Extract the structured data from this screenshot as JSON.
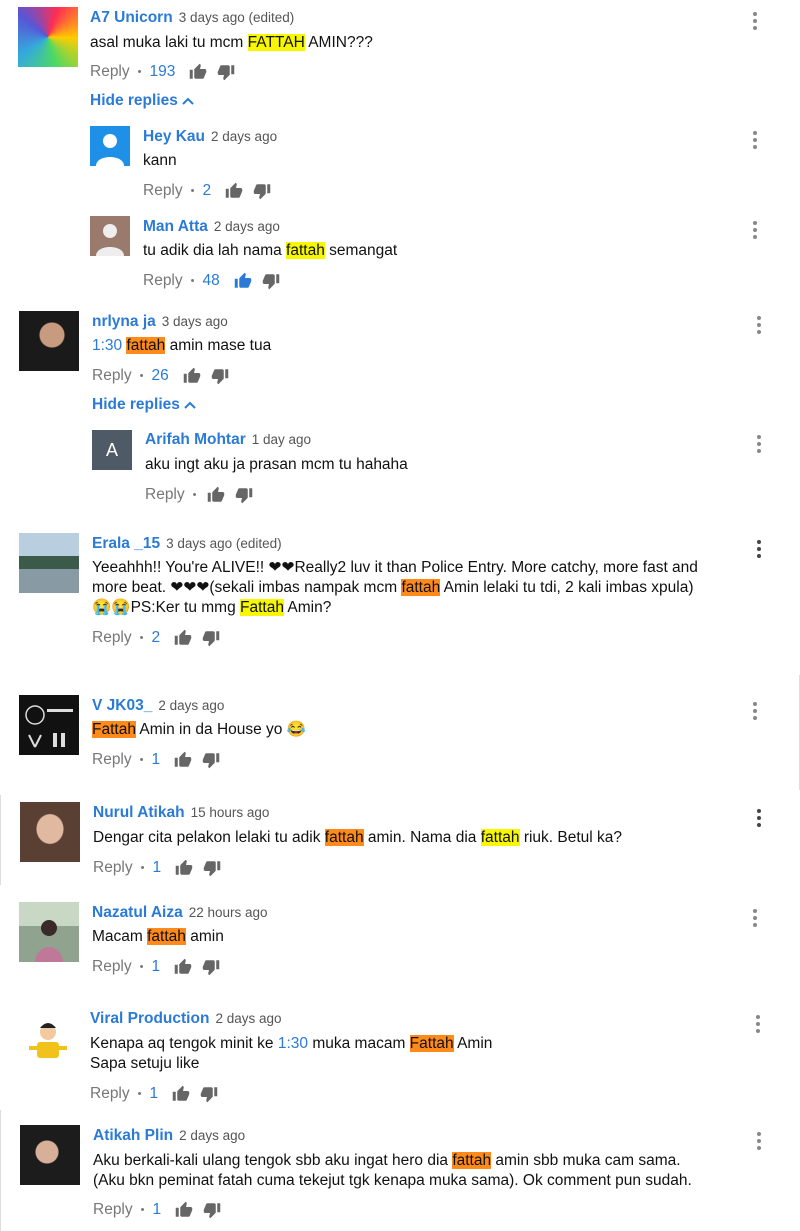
{
  "comments": [
    {
      "author": "A7 Unicorn",
      "time": "3 days ago (edited)",
      "reply": "Reply",
      "count": "193",
      "text_parts": [
        {
          "t": "asal muka laki tu mcm "
        },
        {
          "t": "FATTAH",
          "h": "y"
        },
        {
          "t": " AMIN???"
        }
      ],
      "hide": "Hide replies"
    },
    {
      "author": "Hey Kau",
      "time": "2 days ago",
      "reply": "Reply",
      "count": "2",
      "text_parts": [
        {
          "t": "kann"
        }
      ]
    },
    {
      "author": "Man Atta",
      "time": "2 days ago",
      "reply": "Reply",
      "count": "48",
      "text_parts": [
        {
          "t": "tu adik dia lah nama "
        },
        {
          "t": "fattah",
          "h": "y"
        },
        {
          "t": " semangat"
        }
      ]
    },
    {
      "author": "nrlyna ja",
      "time": "3 days ago",
      "reply": "Reply",
      "count": "26",
      "text_parts": [
        {
          "t": "1:30",
          "ts": true
        },
        {
          "t": " "
        },
        {
          "t": "fattah",
          "h": "o"
        },
        {
          "t": " amin mase tua"
        }
      ],
      "hide": "Hide replies"
    },
    {
      "author": "Arifah Mohtar",
      "time": "1 day ago",
      "reply": "Reply",
      "count": "",
      "avatar_letter": "A",
      "text_parts": [
        {
          "t": "aku ingt aku ja prasan mcm tu hahaha"
        }
      ]
    },
    {
      "author": "Erala _15",
      "time": "3 days ago (edited)",
      "reply": "Reply",
      "count": "2",
      "text_parts": [
        {
          "t": "Yeeahhh!! You're ALIVE!! ❤❤Really2 luv it than Police Entry. More catchy, more fast and\nmore beat. ❤❤❤(sekali imbas nampak mcm "
        },
        {
          "t": "fattah",
          "h": "o"
        },
        {
          "t": " Amin lelaki tu tdi, 2 kali imbas xpula)\n😭😭PS:Ker tu mmg "
        },
        {
          "t": "Fattah",
          "h": "y"
        },
        {
          "t": " Amin?"
        }
      ]
    },
    {
      "author": "V JK03_",
      "time": "2 days ago",
      "reply": "Reply",
      "count": "1",
      "text_parts": [
        {
          "t": "Fattah",
          "h": "o"
        },
        {
          "t": " Amin in da House yo 😂"
        }
      ]
    },
    {
      "author": "Nurul Atikah",
      "time": "15 hours ago",
      "reply": "Reply",
      "count": "1",
      "text_parts": [
        {
          "t": "Dengar cita pelakon lelaki tu adik "
        },
        {
          "t": "fattah",
          "h": "o"
        },
        {
          "t": " amin. Nama dia "
        },
        {
          "t": "fattah",
          "h": "y"
        },
        {
          "t": " riuk. Betul ka?"
        }
      ]
    },
    {
      "author": "Nazatul Aiza",
      "time": "22 hours ago",
      "reply": "Reply",
      "count": "1",
      "text_parts": [
        {
          "t": "Macam "
        },
        {
          "t": "fattah",
          "h": "o"
        },
        {
          "t": " amin"
        }
      ]
    },
    {
      "author": "Viral Production",
      "time": "2 days ago",
      "reply": "Reply",
      "count": "1",
      "text_parts": [
        {
          "t": "Kenapa aq tengok minit ke "
        },
        {
          "t": "1:30",
          "ts": true
        },
        {
          "t": " muka macam "
        },
        {
          "t": "Fattah",
          "h": "o"
        },
        {
          "t": " Amin\nSapa setuju like"
        }
      ]
    },
    {
      "author": "Atikah Plin",
      "time": "2 days ago",
      "reply": "Reply",
      "count": "1",
      "text_parts": [
        {
          "t": "Aku berkali-kali ulang tengok sbb aku ingat hero dia "
        },
        {
          "t": "fattah",
          "h": "o"
        },
        {
          "t": " amin sbb muka cam sama.\n(Aku bkn peminat fatah cuma tekejut tgk kenapa muka sama). Ok comment pun sudah."
        }
      ]
    }
  ],
  "icons": {
    "like": "thumbs-up-icon",
    "dislike": "thumbs-down-icon",
    "more": "more-vert-icon",
    "chevron": "chevron-up-icon"
  },
  "colors": {
    "link": "#2b7bd6",
    "highlight_yellow": "#f6f700",
    "highlight_orange": "#ff8a1c"
  }
}
